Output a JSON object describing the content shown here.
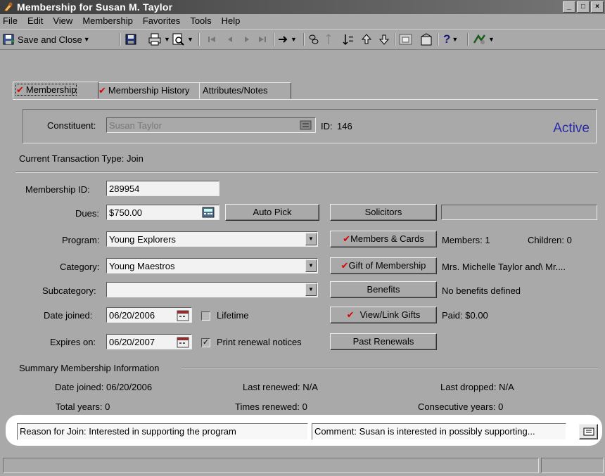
{
  "window": {
    "title": "Membership for Susan M. Taylor"
  },
  "menu": [
    "File",
    "Edit",
    "View",
    "Membership",
    "Favorites",
    "Tools",
    "Help"
  ],
  "toolbar": {
    "save_close_label": "Save and Close"
  },
  "tabs": [
    {
      "label": "Membership",
      "checked": true,
      "active": true
    },
    {
      "label": "Membership History",
      "checked": true,
      "active": false
    },
    {
      "label": "Attributes/Notes",
      "checked": false,
      "active": false
    }
  ],
  "constituent": {
    "label": "Constituent:",
    "value": "Susan Taylor",
    "id_label": "ID:",
    "id_value": "146",
    "status": "Active"
  },
  "transaction_type": "Current Transaction Type: Join",
  "form": {
    "membership_id_label": "Membership ID:",
    "membership_id": "289954",
    "dues_label": "Dues:",
    "dues": "$750.00",
    "program_label": "Program:",
    "program": "Young Explorers",
    "category_label": "Category:",
    "category": "Young Maestros",
    "subcategory_label": "Subcategory:",
    "subcategory": "",
    "date_joined_label": "Date joined:",
    "date_joined": "06/20/2006",
    "expires_label": "Expires on:",
    "expires": "06/20/2007",
    "lifetime_label": "Lifetime",
    "lifetime_checked": false,
    "renewal_label": "Print renewal notices",
    "renewal_checked": true
  },
  "buttons": {
    "auto_pick": "Auto Pick",
    "solicitors": "Solicitors",
    "members_cards": "Members & Cards",
    "gift_membership": "Gift of Membership",
    "benefits": "Benefits",
    "view_link_gifts": "View/Link Gifts",
    "past_renewals": "Past Renewals"
  },
  "info": {
    "solicitor_value": "",
    "members": "Members: 1",
    "children": "Children: 0",
    "gift_of": "Mrs. Michelle Taylor and\\ Mr....",
    "benefits": "No benefits defined",
    "paid": "Paid: $0.00"
  },
  "summary": {
    "heading": "Summary Membership Information",
    "date_joined": "Date joined: 06/20/2006",
    "last_renewed": "Last renewed: N/A",
    "last_dropped": "Last dropped: N/A",
    "total_years": "Total years: 0",
    "times_renewed": "Times renewed: 0",
    "consecutive_years": "Consecutive years: 0"
  },
  "bottom": {
    "reason": "Reason for Join: Interested in supporting the program",
    "comment": "Comment: Susan is interested in possibly supporting..."
  },
  "colors": {
    "background": "#a9a9a9",
    "status_active": "#2a2aa8",
    "check_mark": "#dd0000"
  }
}
